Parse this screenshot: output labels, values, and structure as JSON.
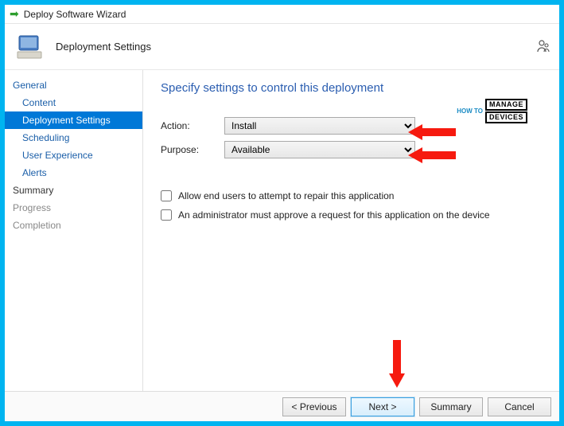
{
  "window": {
    "title": "Deploy Software Wizard"
  },
  "header": {
    "page_title": "Deployment Settings"
  },
  "sidebar": {
    "items": [
      {
        "label": "General",
        "kind": "top"
      },
      {
        "label": "Content",
        "kind": "sub"
      },
      {
        "label": "Deployment Settings",
        "kind": "sub_selected"
      },
      {
        "label": "Scheduling",
        "kind": "sub"
      },
      {
        "label": "User Experience",
        "kind": "sub"
      },
      {
        "label": "Alerts",
        "kind": "sub"
      },
      {
        "label": "Summary",
        "kind": "top_dim"
      },
      {
        "label": "Progress",
        "kind": "top_dim"
      },
      {
        "label": "Completion",
        "kind": "top_dim"
      }
    ]
  },
  "content": {
    "heading": "Specify settings to control this deployment",
    "action_label": "Action:",
    "action_value": "Install",
    "purpose_label": "Purpose:",
    "purpose_value": "Available",
    "check_repair": "Allow end users to attempt to repair this application",
    "check_approve": "An administrator must approve a request for this application on the device"
  },
  "footer": {
    "previous": "<  Previous",
    "next": "Next  >",
    "summary": "Summary",
    "cancel": "Cancel"
  },
  "brand": {
    "howto": "HOW TO",
    "manage": "MANAGE",
    "devices": "DEVICES"
  }
}
